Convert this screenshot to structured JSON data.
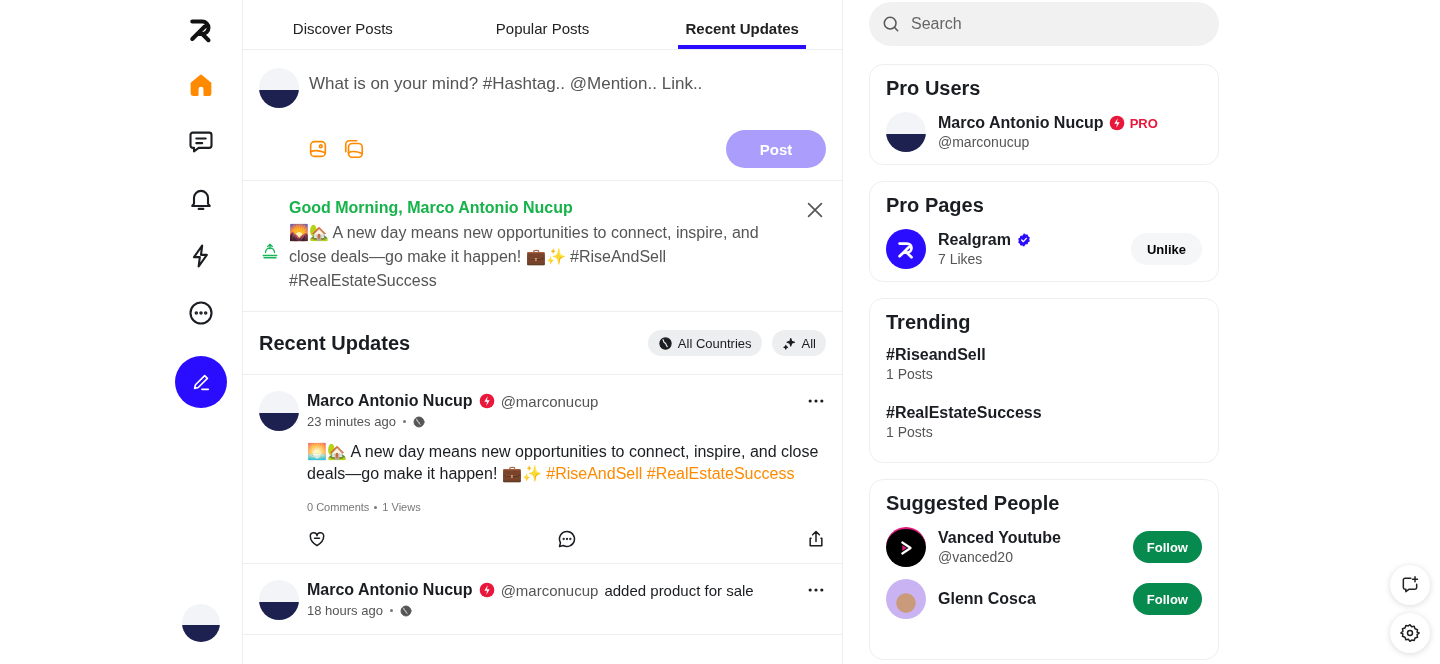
{
  "nav": {
    "items": [
      {
        "kind": "home",
        "selected": true
      },
      {
        "kind": "messages",
        "selected": false
      },
      {
        "kind": "notifications",
        "selected": false
      },
      {
        "kind": "bolt",
        "selected": false
      },
      {
        "kind": "more",
        "selected": false
      }
    ]
  },
  "tabs": [
    {
      "label": "Discover Posts",
      "selected": false
    },
    {
      "label": "Popular Posts",
      "selected": false
    },
    {
      "label": "Recent Updates",
      "selected": true
    }
  ],
  "composer": {
    "placeholder": "What is on your mind? #Hashtag.. @Mention.. Link..",
    "button": "Post",
    "button_disabled": true
  },
  "greeting": {
    "title": "Good Morning, Marco Antonio Nucup",
    "text": "🌄🏡 A new day means new opportunities to connect, inspire, and close deals—go make it happen! 💼✨ #RiseAndSell #RealEstateSuccess"
  },
  "feed": {
    "title": "Recent Updates",
    "filters": [
      {
        "kind": "globe",
        "label": "All Countries"
      },
      {
        "kind": "sparkle",
        "label": "All"
      }
    ]
  },
  "posts": [
    {
      "author": "Marco Antonio Nucup",
      "pro": true,
      "handle": "@marconucup",
      "time": "23 minutes ago",
      "body": [
        {
          "kind": "text",
          "text": "🌅🏡 A new day means new opportunities to connect, inspire, and close deals—go make it happen! 💼✨"
        },
        {
          "kind": "hashtag",
          "text": "#RiseAndSell"
        },
        {
          "kind": "hashtag",
          "text": "#RealEstateSuccess"
        }
      ],
      "comments": "0 Comments",
      "views": "1 Views"
    },
    {
      "author": "Marco Antonio Nucup",
      "pro": true,
      "handle": "@marconucup",
      "action": "added product for sale",
      "time": "18 hours ago"
    }
  ],
  "search": {
    "placeholder": "Search"
  },
  "pro_users": {
    "title": "Pro Users",
    "items": [
      {
        "name": "Marco Antonio Nucup",
        "badge": "PRO",
        "handle": "@marconucup"
      }
    ]
  },
  "pro_pages": {
    "title": "Pro Pages",
    "items": [
      {
        "name": "Realgram",
        "verified": true,
        "likes": "7 Likes",
        "button": "Unlike"
      }
    ]
  },
  "trending": {
    "title": "Trending",
    "items": [
      {
        "tag": "#RiseandSell",
        "count": "1 Posts"
      },
      {
        "tag": "#RealEstateSuccess",
        "count": "1 Posts"
      }
    ]
  },
  "suggested": {
    "title": "Suggested People",
    "items": [
      {
        "name": "Vanced Youtube",
        "handle": "@vanced20",
        "button": "Follow",
        "kind": "play"
      },
      {
        "name": "Glenn Cosca",
        "button": "Follow",
        "kind": "cartoon"
      }
    ]
  }
}
